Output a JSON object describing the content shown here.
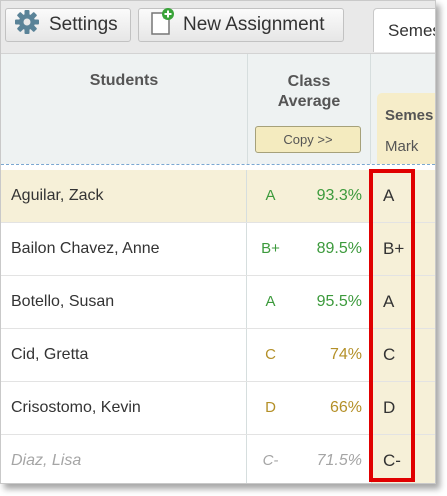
{
  "toolbar": {
    "settings_label": "Settings",
    "new_assignment_label": "New Assignment",
    "tab_label": "Semes"
  },
  "header": {
    "students_label": "Students",
    "class_average_label": "Class Average",
    "copy_label": "Copy >>",
    "semester_label": "Semes",
    "mark_label": "Mark"
  },
  "students": [
    {
      "name": "Aguilar, Zack",
      "letter": "A",
      "percent": "93.3%",
      "mark": "A"
    },
    {
      "name": "Bailon Chavez, Anne",
      "letter": "B+",
      "percent": "89.5%",
      "mark": "B+"
    },
    {
      "name": "Botello, Susan",
      "letter": "A",
      "percent": "95.5%",
      "mark": "A"
    },
    {
      "name": "Cid, Gretta",
      "letter": "C",
      "percent": "74%",
      "mark": "C"
    },
    {
      "name": "Crisostomo, Kevin",
      "letter": "D",
      "percent": "66%",
      "mark": "D"
    },
    {
      "name": "Diaz, Lisa",
      "letter": "C-",
      "percent": "71.5%",
      "mark": "C-"
    }
  ],
  "colors": {
    "grade_good": "#3c9a3c",
    "grade_mid": "#b49028",
    "highlight": "#e00000"
  }
}
